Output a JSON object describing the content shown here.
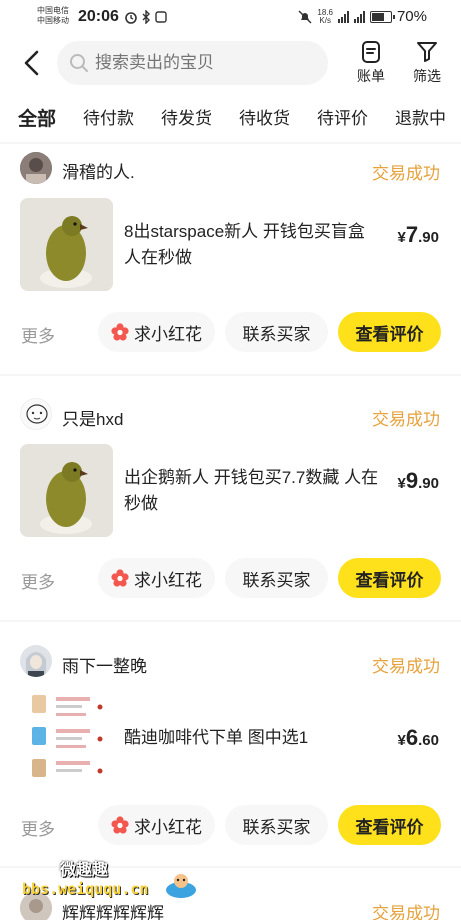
{
  "status_bar": {
    "carrier1": "中国电信",
    "carrier2": "中国移动",
    "time": "20:06",
    "net_speed_value": "18.6",
    "net_speed_unit": "K/s",
    "battery": "70%",
    "battery_level": 0.7
  },
  "header": {
    "search_placeholder": "搜索卖出的宝贝",
    "bill_label": "账单",
    "filter_label": "筛选"
  },
  "tabs": [
    "全部",
    "待付款",
    "待发货",
    "待收货",
    "待评价",
    "退款中"
  ],
  "orders": [
    {
      "seller": "滑稽的人.",
      "status": "交易成功",
      "title": "8出starspace新人 开钱包买盲盒 人在秒做",
      "price_currency": "¥",
      "price_int": "7",
      "price_dec": ".90",
      "more": "更多",
      "flower_btn": "求小红花",
      "contact_btn": "联系买家",
      "review_btn": "查看评价"
    },
    {
      "seller": "只是hxd",
      "status": "交易成功",
      "title": "出企鹅新人 开钱包买7.7数藏 人在秒做",
      "price_currency": "¥",
      "price_int": "9",
      "price_dec": ".90",
      "more": "更多",
      "flower_btn": "求小红花",
      "contact_btn": "联系买家",
      "review_btn": "查看评价"
    },
    {
      "seller": "雨下一整晚",
      "status": "交易成功",
      "title": "酷迪咖啡代下单 图中选1",
      "price_currency": "¥",
      "price_int": "6",
      "price_dec": ".60",
      "more": "更多",
      "flower_btn": "求小红花",
      "contact_btn": "联系买家",
      "review_btn": "查看评价"
    },
    {
      "seller": "辉辉辉辉辉辉",
      "status": "交易成功"
    }
  ],
  "watermark": {
    "text_cn": "微趣趣",
    "url": "bbs.weiququ.cn"
  },
  "colors": {
    "accent_yellow": "#ffe11b",
    "status_orange": "#e6a23c",
    "flower_red": "#f2584f"
  }
}
